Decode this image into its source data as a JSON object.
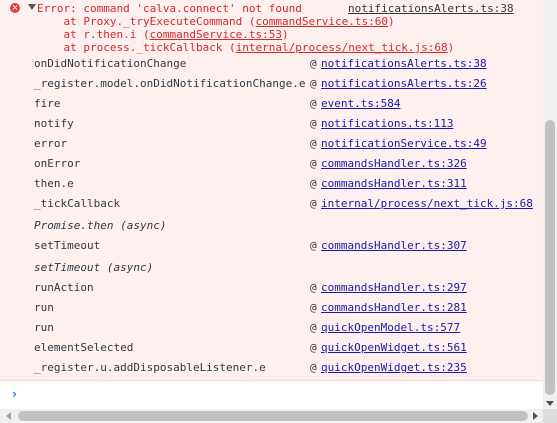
{
  "error": {
    "message": "Error: command 'calva.connect' not found",
    "source": "notificationsAlerts.ts:38",
    "stack": [
      {
        "prefix": "    at Proxy._tryExecuteCommand (",
        "file": "commandService.ts:60",
        "suffix": ")"
      },
      {
        "prefix": "    at r.then.i (",
        "file": "commandService.ts:53",
        "suffix": ")"
      },
      {
        "prefix": "    at process._tickCallback (",
        "file": "internal/process/next_tick.js:68",
        "suffix": ")"
      }
    ]
  },
  "frames": [
    {
      "fn": "onDidNotificationChange",
      "at": "@",
      "link": "notificationsAlerts.ts:38"
    },
    {
      "fn": "_register.model.onDidNotificationChange.e",
      "at": "@",
      "link": "notificationsAlerts.ts:26"
    },
    {
      "fn": "fire",
      "at": "@",
      "link": "event.ts:584"
    },
    {
      "fn": "notify",
      "at": "@",
      "link": "notifications.ts:113"
    },
    {
      "fn": "error",
      "at": "@",
      "link": "notificationService.ts:49"
    },
    {
      "fn": "onError",
      "at": "@",
      "link": "commandsHandler.ts:326"
    },
    {
      "fn": "then.e",
      "at": "@",
      "link": "commandsHandler.ts:311"
    },
    {
      "fn": "_tickCallback",
      "at": "@",
      "link": "internal/process/next_tick.js:68"
    }
  ],
  "async1": "Promise.then (async)",
  "frames2": [
    {
      "fn": "setTimeout",
      "at": "@",
      "link": "commandsHandler.ts:307"
    }
  ],
  "async2": "setTimeout (async)",
  "frames3": [
    {
      "fn": "runAction",
      "at": "@",
      "link": "commandsHandler.ts:297"
    },
    {
      "fn": "run",
      "at": "@",
      "link": "commandsHandler.ts:281"
    },
    {
      "fn": "run",
      "at": "@",
      "link": "quickOpenModel.ts:577"
    },
    {
      "fn": "elementSelected",
      "at": "@",
      "link": "quickOpenWidget.ts:561"
    },
    {
      "fn": "_register.u.addDisposableListener.e",
      "at": "@",
      "link": "quickOpenWidget.ts:235"
    }
  ],
  "prompt": "›",
  "icons": {
    "error": "error-circle-icon",
    "expand": "expand-triangle-icon"
  }
}
